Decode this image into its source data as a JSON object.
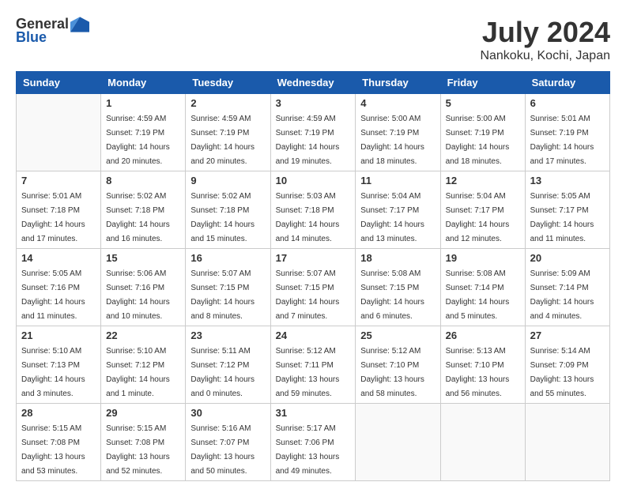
{
  "logo": {
    "general": "General",
    "blue": "Blue"
  },
  "title": "July 2024",
  "location": "Nankoku, Kochi, Japan",
  "days_of_week": [
    "Sunday",
    "Monday",
    "Tuesday",
    "Wednesday",
    "Thursday",
    "Friday",
    "Saturday"
  ],
  "weeks": [
    [
      {
        "num": "",
        "sunrise": "",
        "sunset": "",
        "daylight": "",
        "empty": true
      },
      {
        "num": "1",
        "sunrise": "Sunrise: 4:59 AM",
        "sunset": "Sunset: 7:19 PM",
        "daylight": "Daylight: 14 hours and 20 minutes."
      },
      {
        "num": "2",
        "sunrise": "Sunrise: 4:59 AM",
        "sunset": "Sunset: 7:19 PM",
        "daylight": "Daylight: 14 hours and 20 minutes."
      },
      {
        "num": "3",
        "sunrise": "Sunrise: 4:59 AM",
        "sunset": "Sunset: 7:19 PM",
        "daylight": "Daylight: 14 hours and 19 minutes."
      },
      {
        "num": "4",
        "sunrise": "Sunrise: 5:00 AM",
        "sunset": "Sunset: 7:19 PM",
        "daylight": "Daylight: 14 hours and 18 minutes."
      },
      {
        "num": "5",
        "sunrise": "Sunrise: 5:00 AM",
        "sunset": "Sunset: 7:19 PM",
        "daylight": "Daylight: 14 hours and 18 minutes."
      },
      {
        "num": "6",
        "sunrise": "Sunrise: 5:01 AM",
        "sunset": "Sunset: 7:19 PM",
        "daylight": "Daylight: 14 hours and 17 minutes."
      }
    ],
    [
      {
        "num": "7",
        "sunrise": "Sunrise: 5:01 AM",
        "sunset": "Sunset: 7:18 PM",
        "daylight": "Daylight: 14 hours and 17 minutes."
      },
      {
        "num": "8",
        "sunrise": "Sunrise: 5:02 AM",
        "sunset": "Sunset: 7:18 PM",
        "daylight": "Daylight: 14 hours and 16 minutes."
      },
      {
        "num": "9",
        "sunrise": "Sunrise: 5:02 AM",
        "sunset": "Sunset: 7:18 PM",
        "daylight": "Daylight: 14 hours and 15 minutes."
      },
      {
        "num": "10",
        "sunrise": "Sunrise: 5:03 AM",
        "sunset": "Sunset: 7:18 PM",
        "daylight": "Daylight: 14 hours and 14 minutes."
      },
      {
        "num": "11",
        "sunrise": "Sunrise: 5:04 AM",
        "sunset": "Sunset: 7:17 PM",
        "daylight": "Daylight: 14 hours and 13 minutes."
      },
      {
        "num": "12",
        "sunrise": "Sunrise: 5:04 AM",
        "sunset": "Sunset: 7:17 PM",
        "daylight": "Daylight: 14 hours and 12 minutes."
      },
      {
        "num": "13",
        "sunrise": "Sunrise: 5:05 AM",
        "sunset": "Sunset: 7:17 PM",
        "daylight": "Daylight: 14 hours and 11 minutes."
      }
    ],
    [
      {
        "num": "14",
        "sunrise": "Sunrise: 5:05 AM",
        "sunset": "Sunset: 7:16 PM",
        "daylight": "Daylight: 14 hours and 11 minutes."
      },
      {
        "num": "15",
        "sunrise": "Sunrise: 5:06 AM",
        "sunset": "Sunset: 7:16 PM",
        "daylight": "Daylight: 14 hours and 10 minutes."
      },
      {
        "num": "16",
        "sunrise": "Sunrise: 5:07 AM",
        "sunset": "Sunset: 7:15 PM",
        "daylight": "Daylight: 14 hours and 8 minutes."
      },
      {
        "num": "17",
        "sunrise": "Sunrise: 5:07 AM",
        "sunset": "Sunset: 7:15 PM",
        "daylight": "Daylight: 14 hours and 7 minutes."
      },
      {
        "num": "18",
        "sunrise": "Sunrise: 5:08 AM",
        "sunset": "Sunset: 7:15 PM",
        "daylight": "Daylight: 14 hours and 6 minutes."
      },
      {
        "num": "19",
        "sunrise": "Sunrise: 5:08 AM",
        "sunset": "Sunset: 7:14 PM",
        "daylight": "Daylight: 14 hours and 5 minutes."
      },
      {
        "num": "20",
        "sunrise": "Sunrise: 5:09 AM",
        "sunset": "Sunset: 7:14 PM",
        "daylight": "Daylight: 14 hours and 4 minutes."
      }
    ],
    [
      {
        "num": "21",
        "sunrise": "Sunrise: 5:10 AM",
        "sunset": "Sunset: 7:13 PM",
        "daylight": "Daylight: 14 hours and 3 minutes."
      },
      {
        "num": "22",
        "sunrise": "Sunrise: 5:10 AM",
        "sunset": "Sunset: 7:12 PM",
        "daylight": "Daylight: 14 hours and 1 minute."
      },
      {
        "num": "23",
        "sunrise": "Sunrise: 5:11 AM",
        "sunset": "Sunset: 7:12 PM",
        "daylight": "Daylight: 14 hours and 0 minutes."
      },
      {
        "num": "24",
        "sunrise": "Sunrise: 5:12 AM",
        "sunset": "Sunset: 7:11 PM",
        "daylight": "Daylight: 13 hours and 59 minutes."
      },
      {
        "num": "25",
        "sunrise": "Sunrise: 5:12 AM",
        "sunset": "Sunset: 7:10 PM",
        "daylight": "Daylight: 13 hours and 58 minutes."
      },
      {
        "num": "26",
        "sunrise": "Sunrise: 5:13 AM",
        "sunset": "Sunset: 7:10 PM",
        "daylight": "Daylight: 13 hours and 56 minutes."
      },
      {
        "num": "27",
        "sunrise": "Sunrise: 5:14 AM",
        "sunset": "Sunset: 7:09 PM",
        "daylight": "Daylight: 13 hours and 55 minutes."
      }
    ],
    [
      {
        "num": "28",
        "sunrise": "Sunrise: 5:15 AM",
        "sunset": "Sunset: 7:08 PM",
        "daylight": "Daylight: 13 hours and 53 minutes."
      },
      {
        "num": "29",
        "sunrise": "Sunrise: 5:15 AM",
        "sunset": "Sunset: 7:08 PM",
        "daylight": "Daylight: 13 hours and 52 minutes."
      },
      {
        "num": "30",
        "sunrise": "Sunrise: 5:16 AM",
        "sunset": "Sunset: 7:07 PM",
        "daylight": "Daylight: 13 hours and 50 minutes."
      },
      {
        "num": "31",
        "sunrise": "Sunrise: 5:17 AM",
        "sunset": "Sunset: 7:06 PM",
        "daylight": "Daylight: 13 hours and 49 minutes."
      },
      {
        "num": "",
        "sunrise": "",
        "sunset": "",
        "daylight": "",
        "empty": true
      },
      {
        "num": "",
        "sunrise": "",
        "sunset": "",
        "daylight": "",
        "empty": true
      },
      {
        "num": "",
        "sunrise": "",
        "sunset": "",
        "daylight": "",
        "empty": true
      }
    ]
  ]
}
